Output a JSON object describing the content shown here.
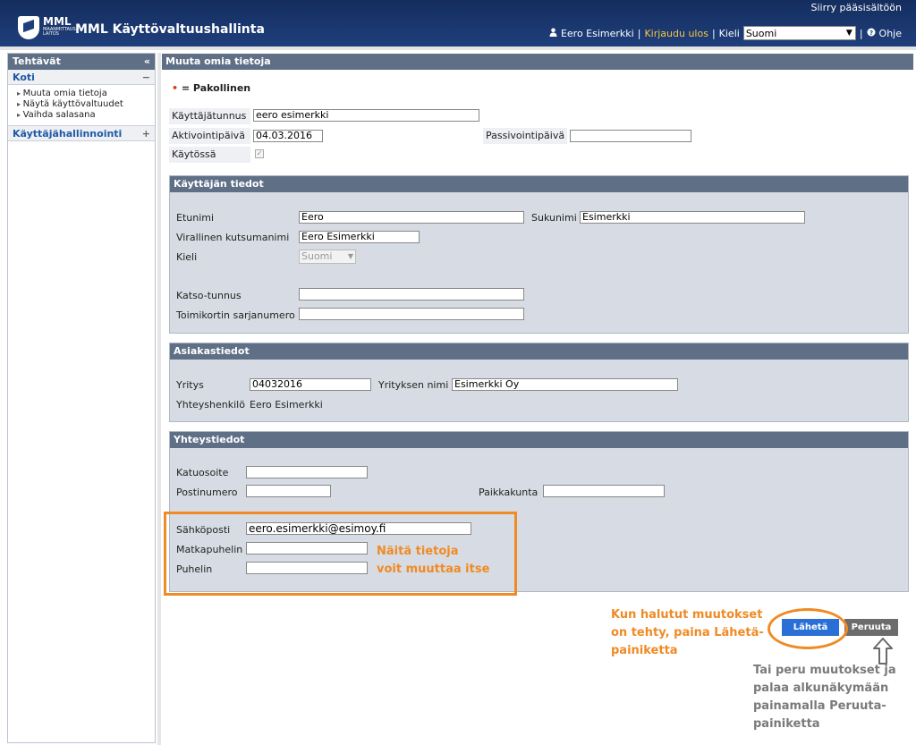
{
  "header": {
    "skip_link": "Siirry pääsisältöön",
    "logo_text": "MML",
    "logo_sub": "MAANMITTAUS-LAITOS",
    "title": "MML Käyttövaltuushallinta",
    "user_icon": "user-icon",
    "user_name": "Eero Esimerkki",
    "logout": "Kirjaudu ulos",
    "language_label": "Kieli",
    "language_value": "Suomi",
    "help_icon": "help-icon",
    "help": "Ohje"
  },
  "sidebar": {
    "title": "Tehtävät",
    "collapse_glyph": "«",
    "home": {
      "label": "Koti",
      "toggle": "−"
    },
    "home_items": [
      "Muuta omia tietoja",
      "Näytä käyttövaltuudet",
      "Vaihda salasana"
    ],
    "admin": {
      "label": "Käyttäjähallinnointi",
      "toggle": "+"
    }
  },
  "main": {
    "title": "Muuta omia tietoja",
    "required_marker": "•",
    "required_text": "= Pakollinen",
    "username_label": "Käyttäjätunnus",
    "username_value": "eero esimerkki",
    "activation_label": "Aktivointipäivä",
    "activation_value": "04.03.2016",
    "passivation_label": "Passivointipäivä",
    "passivation_value": "",
    "in_use_label": "Käytössä",
    "in_use_check": "✓"
  },
  "user_info": {
    "title": "Käyttäjän tiedot",
    "first_name_label": "Etunimi",
    "first_name_value": "Eero",
    "last_name_label": "Sukunimi",
    "last_name_value": "Esimerkki",
    "official_name_label": "Virallinen kutsumanimi",
    "official_name_value": "Eero Esimerkki",
    "language_label": "Kieli",
    "language_value": "Suomi",
    "katso_label": "Katso-tunnus",
    "katso_value": "",
    "card_label": "Toimikortin sarjanumero",
    "card_value": ""
  },
  "customer_info": {
    "title": "Asiakastiedot",
    "company_label": "Yritys",
    "company_value": "04032016",
    "company_name_label": "Yrityksen nimi",
    "company_name_value": "Esimerkki Oy",
    "contact_label": "Yhteyshenkilö",
    "contact_value": "Eero Esimerkki"
  },
  "contact_info": {
    "title": "Yhteystiedot",
    "street_label": "Katuosoite",
    "street_value": "",
    "postcode_label": "Postinumero",
    "postcode_value": "",
    "city_label": "Paikkakunta",
    "city_value": "",
    "email_label": "Sähköposti",
    "email_value": "eero.esimerkki@esimoy.fi",
    "mobile_label": "Matkapuhelin",
    "mobile_value": "",
    "phone_label": "Puhelin",
    "phone_value": ""
  },
  "annotations": {
    "editable_line1": "Näitä tietoja",
    "editable_line2": "voit muuttaa itse",
    "send_hint_line1": "Kun halutut muutokset",
    "send_hint_line2": "on tehty, paina Lähetä-",
    "send_hint_line3": "painiketta",
    "cancel_hint_line1": "Tai peru muutokset ja",
    "cancel_hint_line2": "palaa alkunäkymään",
    "cancel_hint_line3": "painamalla Peruuta-",
    "cancel_hint_line4": "painiketta",
    "accent_color": "#f08a24"
  },
  "buttons": {
    "send": "Lähetä",
    "cancel": "Peruuta"
  }
}
